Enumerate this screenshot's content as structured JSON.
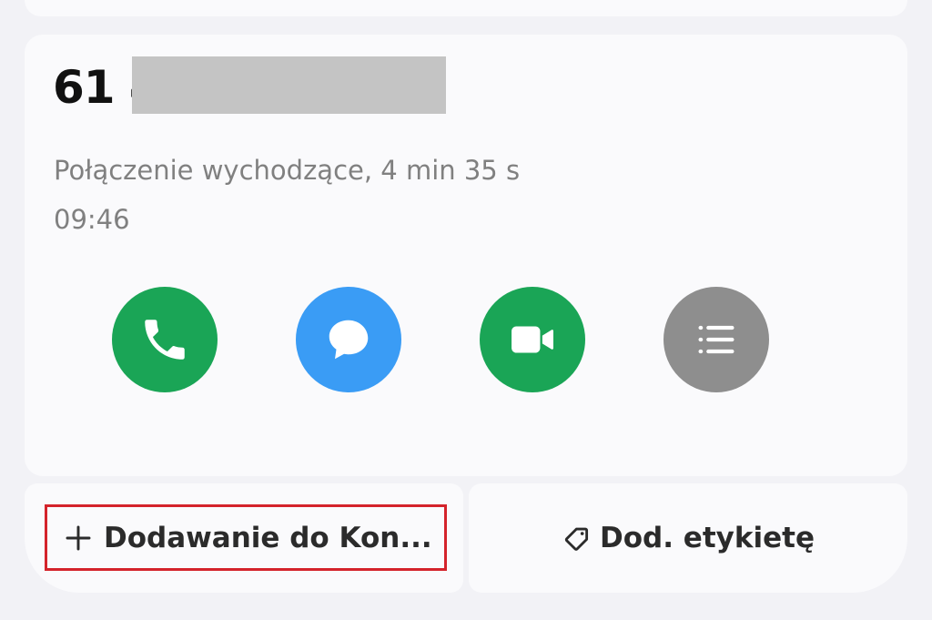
{
  "call_details": {
    "phone_number": "61 4",
    "call_info": "Połączenie wychodzące, 4 min 35 s",
    "call_time": "09:46"
  },
  "actions": [
    {
      "icon": "phone-icon",
      "color": "#1aa556"
    },
    {
      "icon": "message-icon",
      "color": "#3a9cf5"
    },
    {
      "icon": "video-icon",
      "color": "#1aa556"
    },
    {
      "icon": "list-icon",
      "color": "#8e8e8e"
    }
  ],
  "bottom_actions": {
    "add_contact_label": "Dodawanie do Kon...",
    "add_contact_icon": "plus-icon",
    "add_tag_label": "Dod. etykietę",
    "add_tag_icon": "tag-icon",
    "highlight_color": "#d4232b"
  }
}
